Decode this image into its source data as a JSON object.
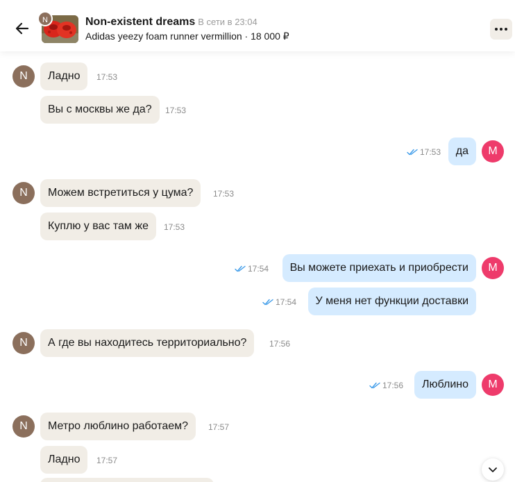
{
  "header": {
    "seller_initial": "N",
    "seller_name": "Non-existent dreams",
    "status": "В сети в 23:04",
    "listing": "Adidas yeezy foam runner vermillion · 18 000 ₽",
    "icons": {
      "back": "arrow-left-icon",
      "more": "ellipsis-icon"
    }
  },
  "colors": {
    "incoming_bubble": "#f1ede6",
    "outgoing_bubble": "#d5ebff",
    "seller_avatar": "#8b6f5c",
    "my_avatar": "#ee3b6b",
    "read_ticks": "#3d9be9"
  },
  "avatars": {
    "seller": "N",
    "me": "M"
  },
  "messages": [
    {
      "dir": "in",
      "text": "Ладно",
      "time": "17:53"
    },
    {
      "dir": "in",
      "text": "Вы с москвы же да?",
      "time": "17:53"
    },
    {
      "dir": "out",
      "text": "да",
      "time": "17:53"
    },
    {
      "dir": "in",
      "text": "Можем встретиться у цума?",
      "time": "17:53"
    },
    {
      "dir": "in",
      "text": "Куплю у вас там же",
      "time": "17:53"
    },
    {
      "dir": "out",
      "text": "Вы можете приехать и приобрести",
      "time": "17:54"
    },
    {
      "dir": "out",
      "text": "У меня нет функции доставки",
      "time": "17:54"
    },
    {
      "dir": "in",
      "text": "А где вы находитесь территориально?",
      "time": "17:56"
    },
    {
      "dir": "out",
      "text": "Люблино",
      "time": "17:56"
    },
    {
      "dir": "in",
      "text": "Метро люблино работаем?",
      "time": "17:57"
    },
    {
      "dir": "in",
      "text": "Ладно",
      "time": "17:57"
    }
  ]
}
